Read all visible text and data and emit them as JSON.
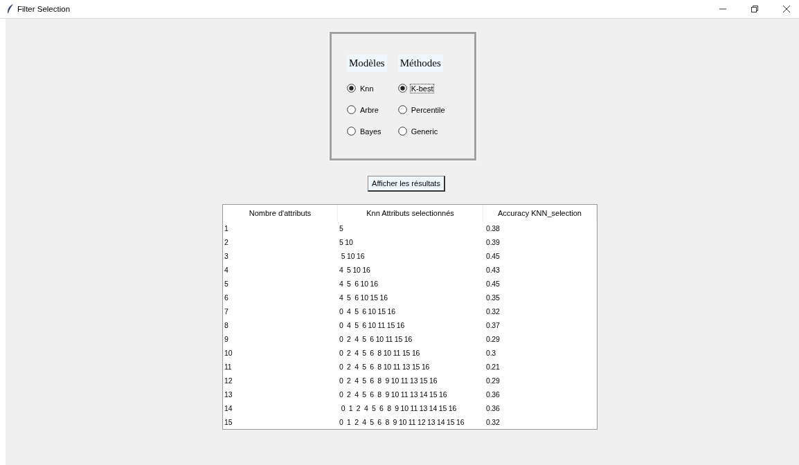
{
  "window": {
    "title": "Filter Selection"
  },
  "groups": [
    {
      "heading": "Modèles",
      "options": [
        {
          "label": "Knn",
          "selected": true,
          "focused": false
        },
        {
          "label": "Arbre",
          "selected": false,
          "focused": false
        },
        {
          "label": "Bayes",
          "selected": false,
          "focused": false
        }
      ]
    },
    {
      "heading": "Méthodes",
      "options": [
        {
          "label": "K-best",
          "selected": true,
          "focused": true
        },
        {
          "label": "Percentile",
          "selected": false,
          "focused": false
        },
        {
          "label": "Generic",
          "selected": false,
          "focused": false
        }
      ]
    }
  ],
  "button": "Afficher les résultats",
  "table": {
    "columns": [
      "Nombre d'attributs",
      "Knn Attributs selectionnés",
      "Accuracy KNN_selection"
    ],
    "rows": [
      [
        "1",
        "5",
        "0.38"
      ],
      [
        "2",
        "5 10",
        "0.39"
      ],
      [
        "3",
        " 5 10 16",
        "0.45"
      ],
      [
        "4",
        "4  5 10 16",
        "0.43"
      ],
      [
        "5",
        "4  5  6 10 16",
        "0.45"
      ],
      [
        "6",
        "4  5  6 10 15 16",
        "0.35"
      ],
      [
        "7",
        "0  4  5  6 10 15 16",
        "0.32"
      ],
      [
        "8",
        "0  4  5  6 10 11 15 16",
        "0.37"
      ],
      [
        "9",
        "0  2  4  5  6 10 11 15 16",
        "0.29"
      ],
      [
        "10",
        "0  2  4  5  6  8 10 11 15 16",
        "0.3"
      ],
      [
        "11",
        "0  2  4  5  6  8 10 11 13 15 16",
        "0.21"
      ],
      [
        "12",
        "0  2  4  5  6  8  9 10 11 13 15 16",
        "0.29"
      ],
      [
        "13",
        "0  2  4  5  6  8  9 10 11 13 14 15 16",
        "0.36"
      ],
      [
        "14",
        " 0  1  2  4  5  6  8  9 10 11 13 14 15 16",
        "0.36"
      ],
      [
        "15",
        "0  1  2  4  5  6  8  9 10 11 12 13 14 15 16",
        "0.32"
      ]
    ]
  }
}
